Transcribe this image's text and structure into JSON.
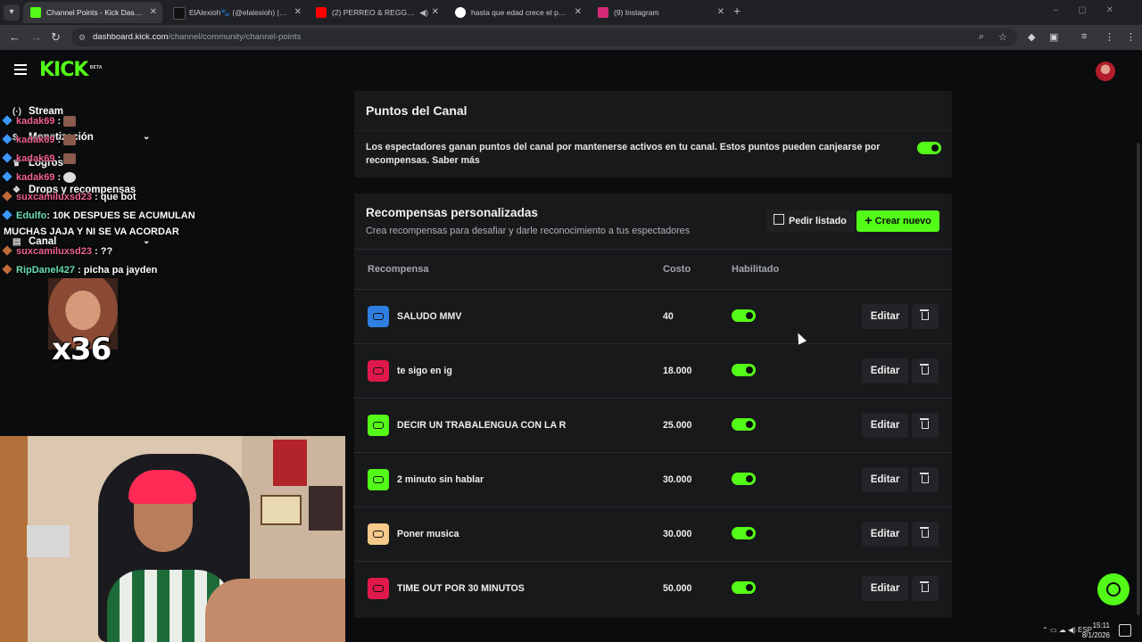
{
  "browser": {
    "tabs": [
      {
        "title": "Channel Points - Kick Dashboar",
        "active": true,
        "fav_color": "#53fc18"
      },
      {
        "title": "ElAlexioh🐾 (@elalexioh) | TikT",
        "active": false,
        "fav_color": "#111111"
      },
      {
        "title": "(2) PERREO & REGGAETON",
        "active": false,
        "fav_color": "#ff0000"
      },
      {
        "title": "hasta que edad crece el pene -",
        "active": false,
        "fav_color": "#4285f4"
      },
      {
        "title": "(9) Instagram",
        "active": false,
        "fav_color": "#d62976"
      }
    ],
    "url_host": "dashboard.kick.com",
    "url_path": "/channel/community/channel-points"
  },
  "header": {
    "logo": "KICK",
    "logo_tag": "BETA"
  },
  "sidebar": {
    "items": [
      {
        "label": "Stream",
        "icon": "broadcast-icon"
      },
      {
        "label": "Monetización",
        "icon": "dollar-icon",
        "expandable": true
      },
      {
        "label": "Logros",
        "icon": "trophy-icon"
      },
      {
        "label": "Drops y recompensas",
        "icon": "gift-icon"
      },
      {
        "label": "Canal",
        "icon": "channel-icon",
        "expandable": true
      }
    ]
  },
  "chat": {
    "lines": [
      {
        "user": "kadak69",
        "msg": " : ",
        "color": "pink"
      },
      {
        "user": "kadak69",
        "msg": " : ",
        "color": "pink"
      },
      {
        "user": "kadak69",
        "msg": " : ",
        "color": "pink"
      },
      {
        "user": "kadak69",
        "msg": " : ",
        "color": "pink"
      },
      {
        "user": "suxcamiluxsd23",
        "msg": " : que bot",
        "color": "pink"
      },
      {
        "user": "Edulfo",
        "msg": ": 10K DESPUES SE ACUMULAN",
        "color": "mint"
      },
      {
        "user": "",
        "msg": "MUCHAS JAJA Y NI SE VA ACORDAR",
        "color": "mint"
      },
      {
        "user": "suxcamiluxsd23",
        "msg": " : ??",
        "color": "pink"
      },
      {
        "user": "RipDanel427",
        "msg": " : picha pa jayden",
        "color": "mint"
      }
    ],
    "emote_count": "x36"
  },
  "channel_points": {
    "title": "Puntos del Canal",
    "description": "Los espectadores ganan puntos del canal por mantenerse activos en tu canal. Estos puntos pueden canjearse por recompensas. Saber más",
    "enabled": true
  },
  "custom_rewards": {
    "title": "Recompensas personalizadas",
    "subtitle": "Crea recompensas para desafiar y darle reconocimiento a tus espectadores",
    "request_button": "Pedir listado",
    "create_button": "Crear nuevo",
    "columns": [
      "Recompensa",
      "Costo",
      "Habilitado"
    ],
    "edit_label": "Editar",
    "rows": [
      {
        "name": "SALUDO MMV",
        "cost": "40",
        "enabled": true,
        "color": "#2f7fe0"
      },
      {
        "name": "te sigo en ig",
        "cost": "18.000",
        "enabled": true,
        "color": "#e0194b"
      },
      {
        "name": "DECIR UN TRABALENGUA CON LA R",
        "cost": "25.000",
        "enabled": true,
        "color": "#53fc18"
      },
      {
        "name": "2 minuto sin hablar",
        "cost": "30.000",
        "enabled": true,
        "color": "#53fc18"
      },
      {
        "name": "Poner musica",
        "cost": "30.000",
        "enabled": true,
        "color": "#f5c98a"
      },
      {
        "name": "TIME OUT POR 30 MINUTOS",
        "cost": "50.000",
        "enabled": true,
        "color": "#e0194b"
      }
    ]
  },
  "taskbar": {
    "lang": "ESP",
    "time": "15:11",
    "date": "8/1/2026"
  }
}
